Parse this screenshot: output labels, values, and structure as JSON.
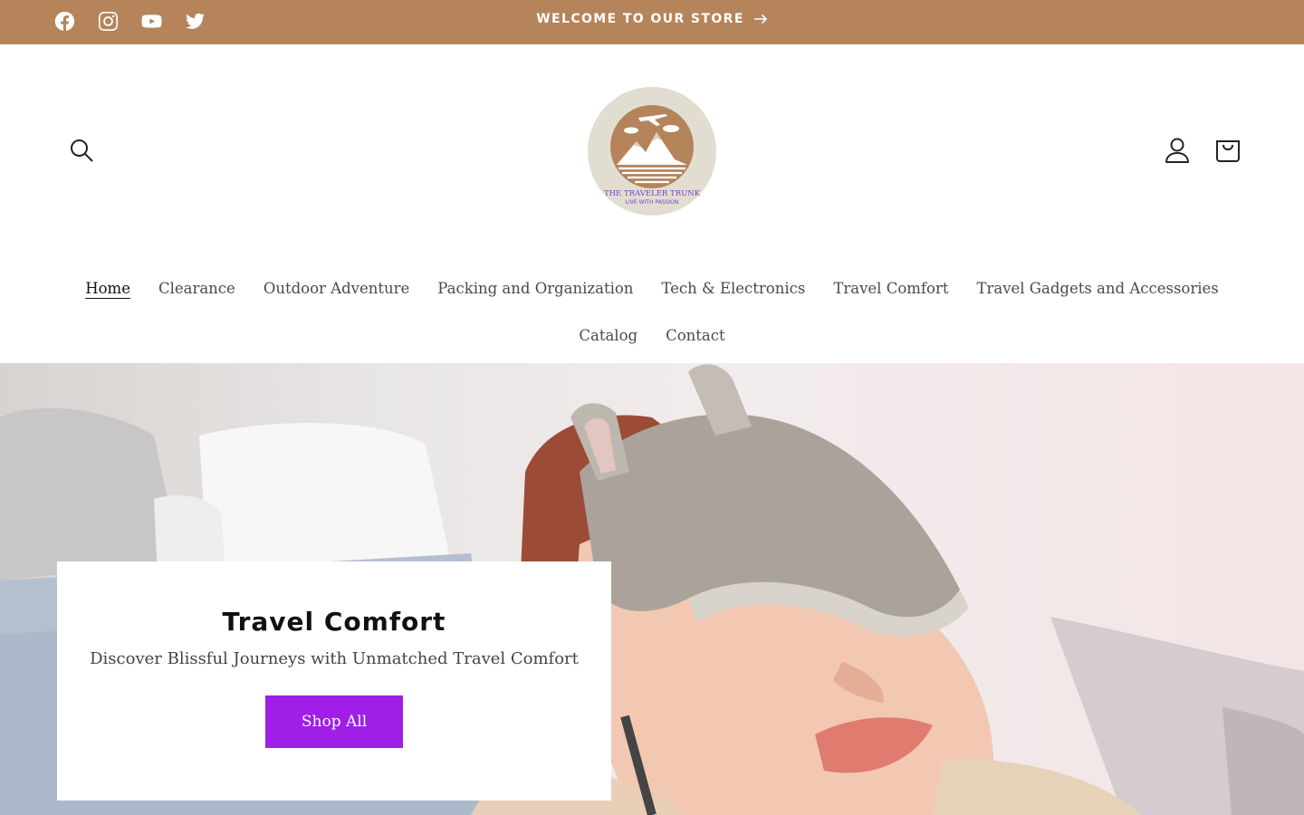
{
  "announcement": {
    "message": "WELCOME TO OUR STORE",
    "background": "#b5845b",
    "social_icons": [
      "facebook-icon",
      "instagram-icon",
      "youtube-icon",
      "twitter-icon"
    ]
  },
  "header": {
    "logo": {
      "brand": "THE TRAVELER TRUNK",
      "tagline": "LIVE WITH PASSION"
    },
    "icons": [
      "search-icon",
      "account-icon",
      "cart-icon"
    ]
  },
  "nav": {
    "row1": [
      "Home",
      "Clearance",
      "Outdoor Adventure",
      "Packing and Organization",
      "Tech & Electronics",
      "Travel Comfort",
      "Travel Gadgets and Accessories"
    ],
    "row2": [
      "Catalog",
      "Contact"
    ],
    "active": "Home"
  },
  "hero": {
    "title": "Travel Comfort",
    "subtitle": "Discover Blissful Journeys with Unmatched Travel Comfort",
    "button_label": "Shop All",
    "button_color": "#9f1fe6"
  }
}
